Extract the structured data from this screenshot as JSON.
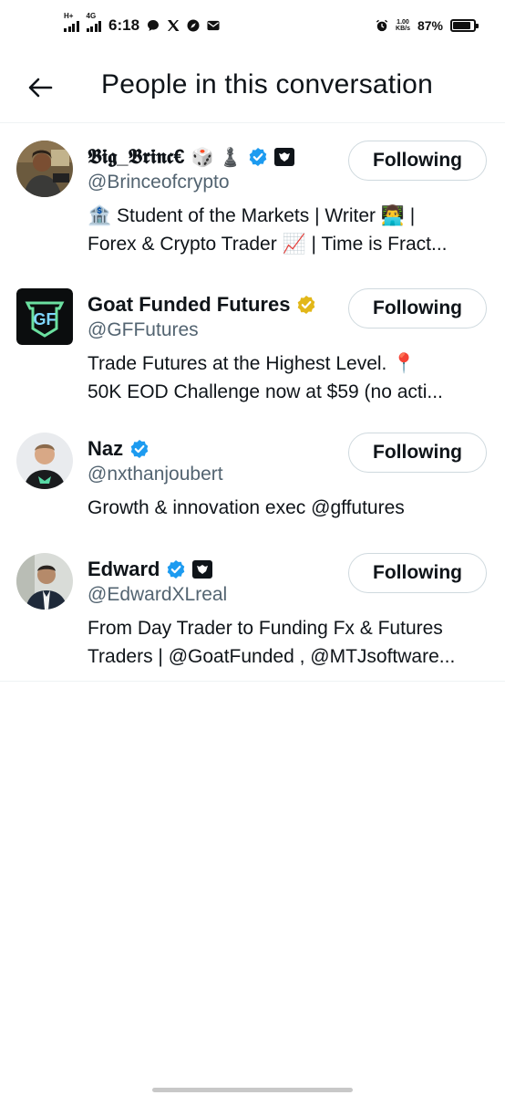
{
  "status_bar": {
    "network_1": "H+",
    "network_2": "4G",
    "time": "6:18",
    "speed_value": "1.00",
    "speed_unit": "KB/s",
    "battery_percent": "87%",
    "battery_level": 0.87,
    "icons": [
      "chat-bubble-icon",
      "x-logo-icon",
      "compass-icon",
      "mail-icon",
      "alarm-icon"
    ]
  },
  "header": {
    "title": "People in this conversation",
    "back_icon": "arrow-left-icon"
  },
  "accent_color": "#1d9bf0",
  "gold_verified_color": "#e2b719",
  "people": [
    {
      "display_name": "𝕭𝖎𝖌_𝕭𝖗𝖎𝖓𝖈€",
      "name_emojis": "🎲 ♟️",
      "handle": "@Brinceofcrypto",
      "verified": "blue",
      "affiliate_badge": true,
      "follow_label": "Following",
      "bio_line_1": "🏦 Student of the Markets | Writer 👨‍💻 |",
      "bio_line_2": "Forex & Crypto Trader 📈 | Time is Fract..."
    },
    {
      "display_name": "Goat Funded Futures",
      "handle": "@GFFutures",
      "verified": "gold",
      "affiliate_badge": false,
      "follow_label": "Following",
      "logo_text": "GF",
      "bio_line_1": "Trade Futures at the Highest Level. 📍",
      "bio_line_2": "50K EOD Challenge now at $59 (no acti..."
    },
    {
      "display_name": "Naz",
      "handle": "@nxthanjoubert",
      "verified": "blue",
      "affiliate_badge": false,
      "follow_label": "Following",
      "bio_line_1": "Growth & innovation exec @gffutures"
    },
    {
      "display_name": "Edward",
      "handle": "@EdwardXLreal",
      "verified": "blue",
      "affiliate_badge": true,
      "follow_label": "Following",
      "bio_line_1": "From Day Trader to Funding Fx & Futures",
      "bio_line_2": "Traders | @GoatFunded , @MTJsoftware..."
    }
  ]
}
